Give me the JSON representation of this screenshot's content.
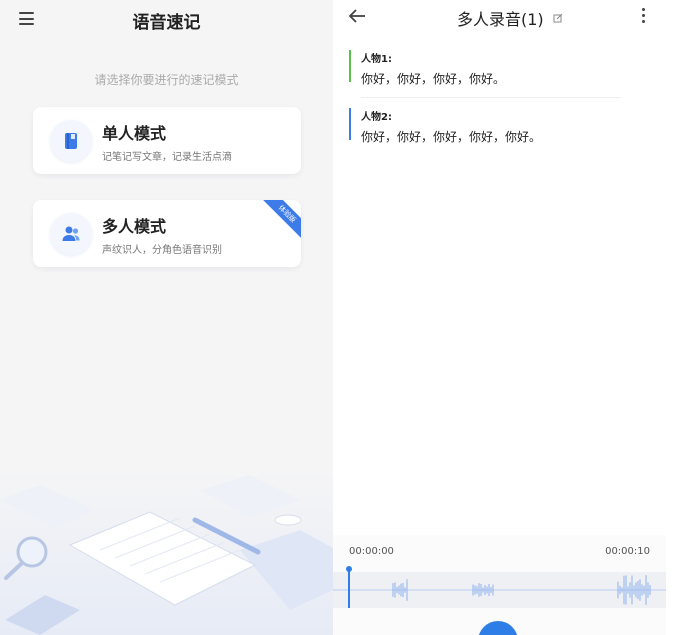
{
  "left": {
    "title": "语音速记",
    "prompt": "请选择你要进行的速记模式",
    "modes": [
      {
        "title": "单人模式",
        "subtitle": "记笔记写文章，记录生活点滴",
        "icon": "book-icon"
      },
      {
        "title": "多人模式",
        "subtitle": "声纹识人，分角色语音识别",
        "icon": "group-icon",
        "ribbon": "体验版"
      }
    ],
    "illustration": "desk-notes-illustration"
  },
  "right": {
    "title": "多人录音(1)",
    "speakers": [
      {
        "name": "人物1:",
        "text": "你好，你好，你好，你好。",
        "color": "#5cc04a"
      },
      {
        "name": "人物2:",
        "text": "你好，你好，你好，你好，你好。",
        "color": "#3d7be8"
      }
    ],
    "player": {
      "time_start": "00:00:00",
      "time_end": "00:00:10",
      "progress": 0
    }
  },
  "colors": {
    "accent": "#2f7de6",
    "speaker1": "#5cc04a",
    "speaker2": "#3d7be8"
  }
}
